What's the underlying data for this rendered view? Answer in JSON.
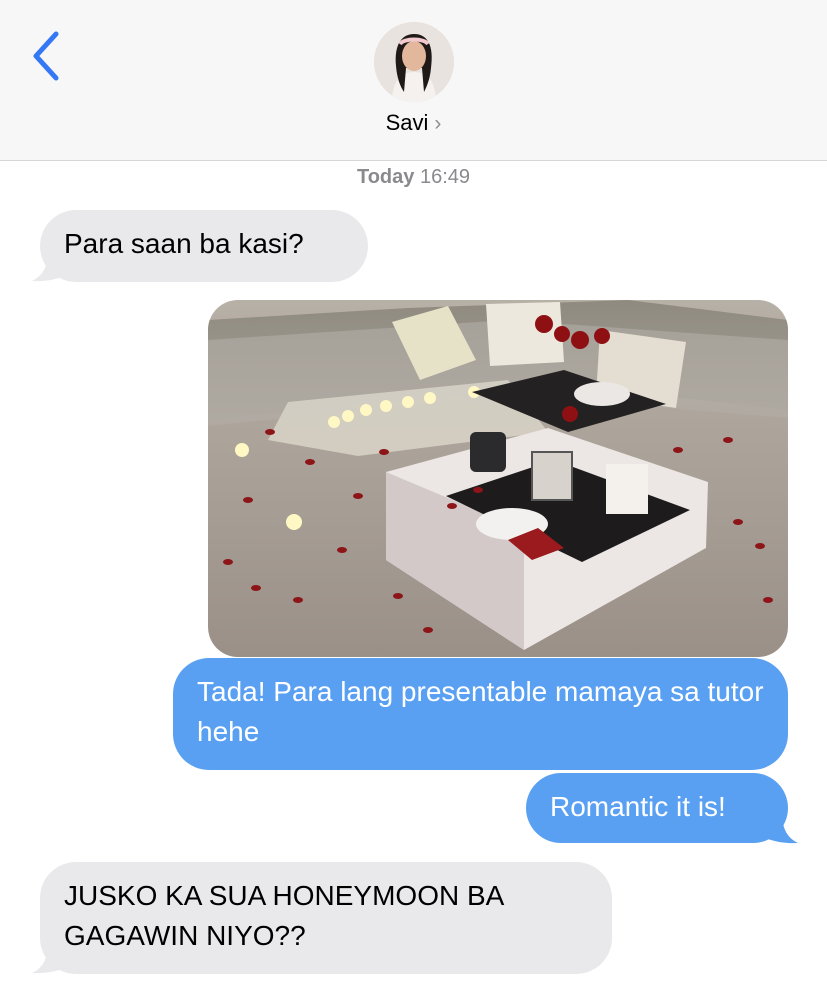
{
  "header": {
    "contact_name": "Savi",
    "chevron": "›",
    "back_icon": "chevron-left-icon",
    "accent_color": "#3478f6"
  },
  "timestamp": {
    "day": "Today",
    "time": "16:49"
  },
  "messages": [
    {
      "direction": "received",
      "text": "Para saan ba kasi?"
    },
    {
      "direction": "sent",
      "type": "image",
      "description_icon": "photo-attachment"
    },
    {
      "direction": "sent",
      "text": "Tada! Para lang presentable mamaya sa tutor hehe"
    },
    {
      "direction": "sent",
      "text": "Romantic it is!"
    },
    {
      "direction": "received",
      "text": "JUSKO KA SUA HONEYMOON BA GAGAWIN NIYO??"
    }
  ],
  "colors": {
    "sent_bubble": "#5aa0f2",
    "received_bubble": "#e9e9eb",
    "header_bg": "#f7f7f7"
  }
}
